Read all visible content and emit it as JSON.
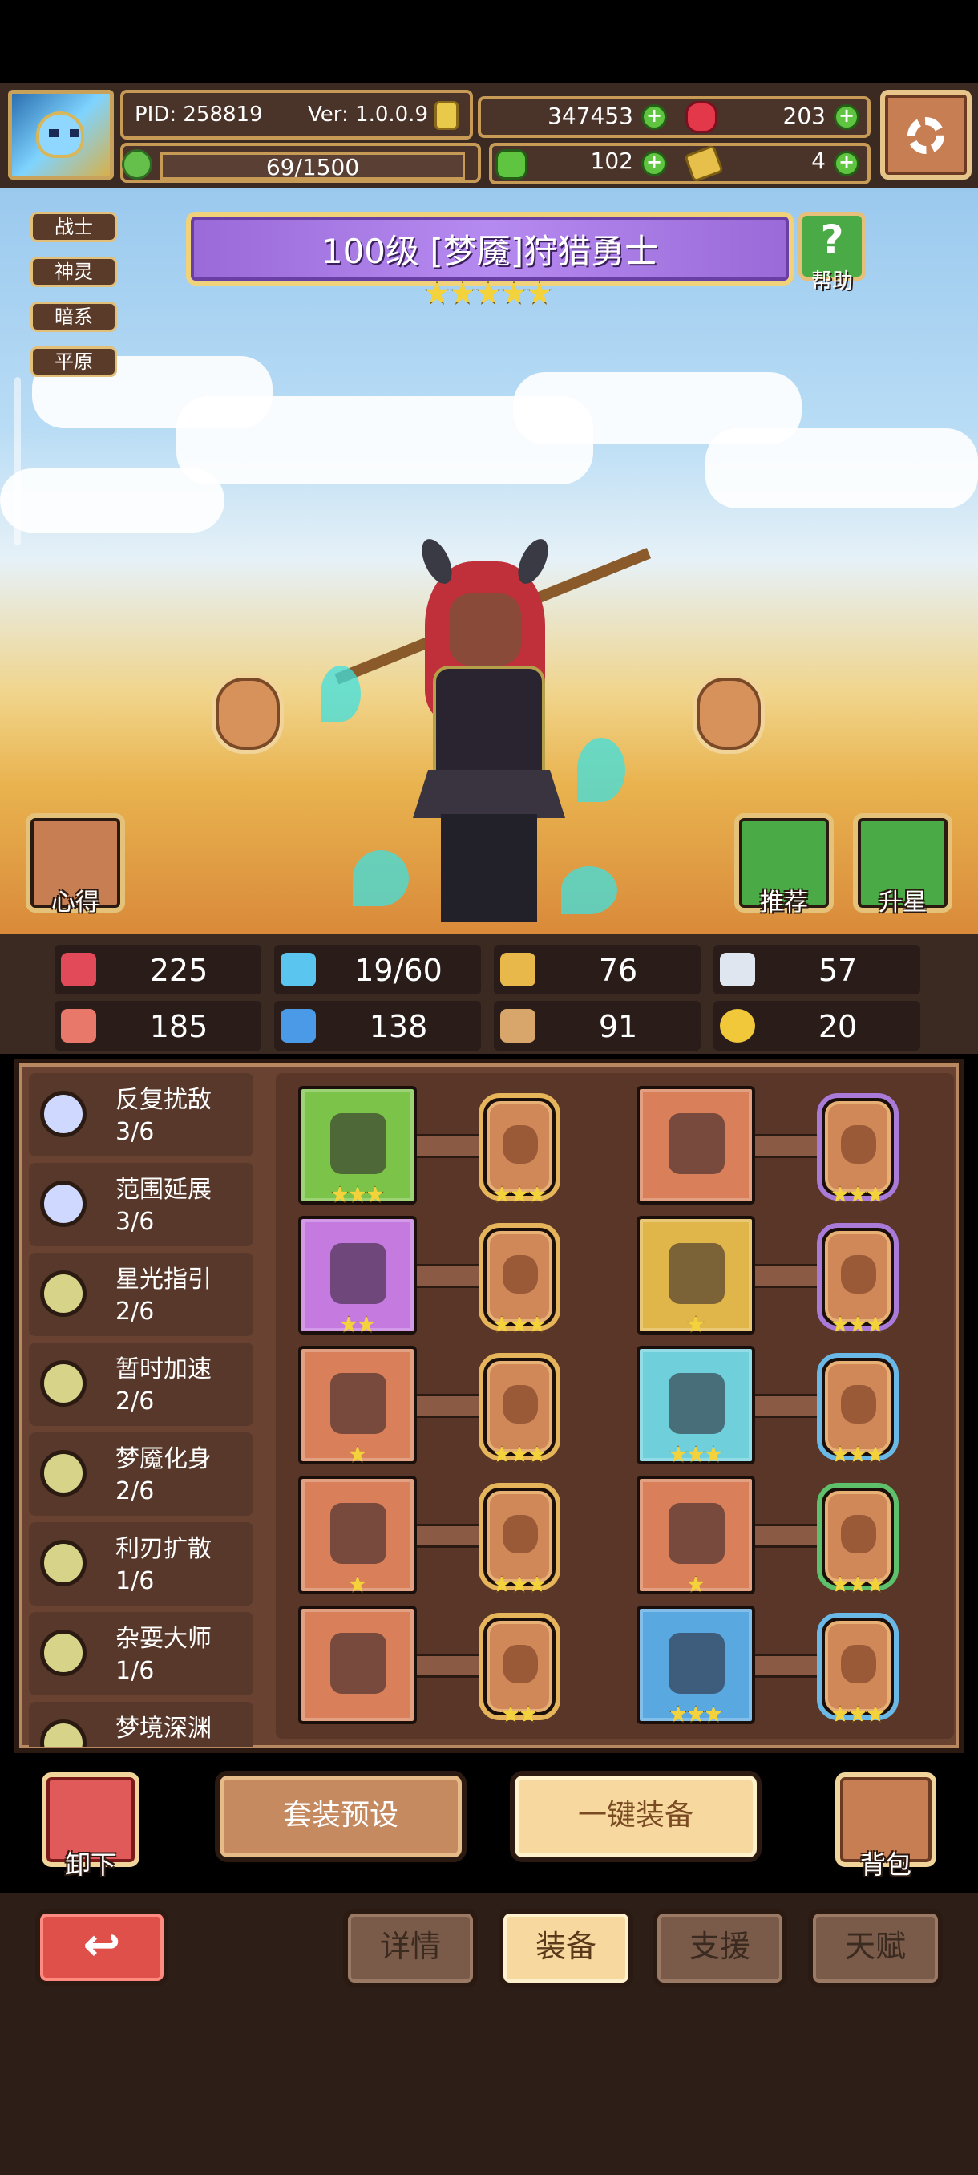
{
  "header": {
    "pid": "PID: 258819",
    "version": "Ver: 1.0.0.9",
    "exp": "69/1500",
    "gold": "347453",
    "gems": "203",
    "clover": "102",
    "keys": "4",
    "plus": "+"
  },
  "hero": {
    "title": "100级 [梦魇]狩猎勇士",
    "stars": 5,
    "help_label": "帮助",
    "tags": [
      "战士",
      "神灵",
      "暗系",
      "平原"
    ],
    "buttons": {
      "notes": "心得",
      "recommend": "推荐",
      "star_up": "升星"
    }
  },
  "stats": {
    "hp": "225",
    "mana": "19/60",
    "defense": "76",
    "speed": "57",
    "attack": "185",
    "magic": "138",
    "armor": "91",
    "crit": "20"
  },
  "set_bonuses": [
    {
      "name": "反复扰敌",
      "count": "3/6",
      "icon_color": "#cfd8ff"
    },
    {
      "name": "范围延展",
      "count": "3/6",
      "icon_color": "#cfd8ff"
    },
    {
      "name": "星光指引",
      "count": "2/6",
      "icon_color": "#d7d48a"
    },
    {
      "name": "暂时加速",
      "count": "2/6",
      "icon_color": "#d7d48a"
    },
    {
      "name": "梦魇化身",
      "count": "2/6",
      "icon_color": "#d7d48a"
    },
    {
      "name": "利刃扩散",
      "count": "1/6",
      "icon_color": "#d7d48a"
    },
    {
      "name": "杂耍大师",
      "count": "1/6",
      "icon_color": "#d7d48a"
    },
    {
      "name": "梦境深渊",
      "count": "",
      "icon_color": "#d7d48a"
    }
  ],
  "equipment": [
    {
      "name": "spear",
      "bg": "#7cc34a",
      "stars": 3,
      "rune_ring": "#e6b45a",
      "rune_stars": 3,
      "col": 0,
      "row": 0
    },
    {
      "name": "goggles",
      "bg": "#d9805a",
      "stars": 0,
      "rune_ring": "#a97ad8",
      "rune_stars": 3,
      "col": 1,
      "row": 0
    },
    {
      "name": "dagger",
      "bg": "#c57adf",
      "stars": 2,
      "rune_ring": "#e6b45a",
      "rune_stars": 3,
      "col": 0,
      "row": 1
    },
    {
      "name": "armor",
      "bg": "#e0b54a",
      "stars": 1,
      "rune_ring": "#a97ad8",
      "rune_stars": 3,
      "col": 1,
      "row": 1
    },
    {
      "name": "heart-necklace",
      "bg": "#d9805a",
      "stars": 1,
      "rune_ring": "#e6b45a",
      "rune_stars": 3,
      "col": 0,
      "row": 2
    },
    {
      "name": "scroll",
      "bg": "#6fd0dc",
      "stars": 3,
      "rune_ring": "#6ab8e6",
      "rune_stars": 3,
      "col": 1,
      "row": 2
    },
    {
      "name": "golden-emblem",
      "bg": "#d9805a",
      "stars": 1,
      "rune_ring": "#e6b45a",
      "rune_stars": 3,
      "col": 0,
      "row": 3
    },
    {
      "name": "flower-bracelet",
      "bg": "#d9805a",
      "stars": 1,
      "rune_ring": "#5ec06a",
      "rune_stars": 3,
      "col": 1,
      "row": 3
    },
    {
      "name": "ring",
      "bg": "#d9805a",
      "stars": 0,
      "rune_ring": "#e6b45a",
      "rune_stars": 2,
      "col": 0,
      "row": 4
    },
    {
      "name": "boots",
      "bg": "#5aa8e0",
      "stars": 3,
      "rune_ring": "#6ab8e6",
      "rune_stars": 3,
      "col": 1,
      "row": 4
    }
  ],
  "actions": {
    "unequip": "卸下",
    "preset": "套装预设",
    "equip_all": "一键装备",
    "bag": "背包"
  },
  "tabs": {
    "back_icon": "↩",
    "details": "详情",
    "equip": "装备",
    "support": "支援",
    "talent": "天赋"
  }
}
